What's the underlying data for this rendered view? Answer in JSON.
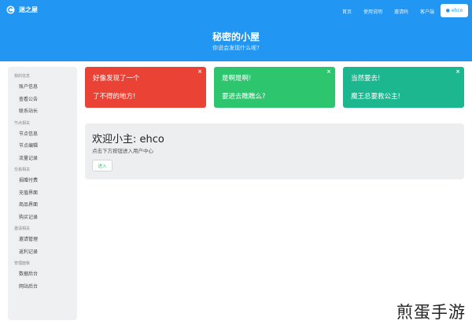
{
  "brand": {
    "name": "迷之屋",
    "logo_icon": "c-logo-icon"
  },
  "nav": {
    "items": [
      "首页",
      "使用说明",
      "邀请码",
      "客户端"
    ]
  },
  "user": {
    "name": "ehco",
    "icon": "user-icon"
  },
  "hero": {
    "title": "秘密的小屋",
    "subtitle": "你说会发现什么呢?"
  },
  "sidebar": {
    "sections": [
      {
        "title": "我的信息",
        "items": [
          "账户信息",
          "查看公告",
          "联系站长"
        ]
      },
      {
        "title": "节点相关",
        "items": [
          "节点信息",
          "节点编辑",
          "流量记录"
        ]
      },
      {
        "title": "交易相关",
        "items": [
          "捐赠付费",
          "充值界面",
          "商品界面",
          "购买记录"
        ]
      },
      {
        "title": "邀请相关",
        "items": [
          "邀请管理",
          "返利记录"
        ]
      },
      {
        "title": "管理面板",
        "items": [
          "数据后台",
          "网站后台"
        ]
      }
    ]
  },
  "cards": [
    {
      "line1": "好像发现了一个",
      "line2": "了不得的地方!",
      "close": "×"
    },
    {
      "line1": "是啊是啊!",
      "line2": "要进去瞧瞧么?",
      "close": "×"
    },
    {
      "line1": "当然要去!",
      "line2": "魔王总要救公主!",
      "close": "×"
    }
  ],
  "welcome": {
    "title": "欢迎小主: ehco",
    "subtitle": "点击下方按钮进入用户中心",
    "button": "进入"
  },
  "watermark": "煎蛋手游",
  "colors": {
    "primary": "#2196f3",
    "red": "#ea4335",
    "green": "#2ec56f",
    "teal": "#1cb68f"
  }
}
